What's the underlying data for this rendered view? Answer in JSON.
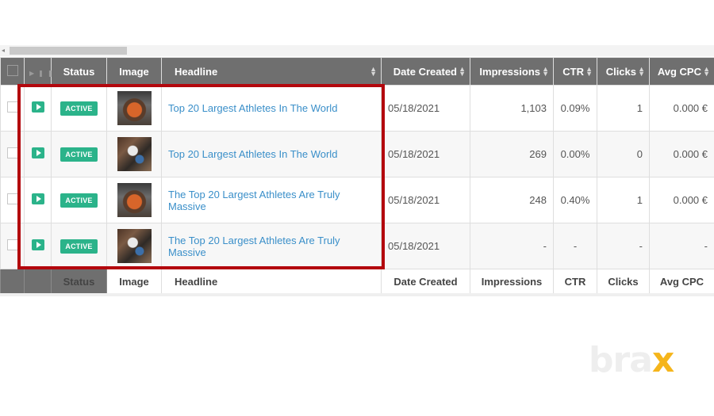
{
  "scrollbar": {
    "left_arrow_icon": "◂"
  },
  "columns": {
    "status": "Status",
    "image": "Image",
    "headline": "Headline",
    "date_created": "Date Created",
    "impressions": "Impressions",
    "ctr": "CTR",
    "clicks": "Clicks",
    "avg_cpc": "Avg CPC"
  },
  "header_icons": {
    "play": "▶",
    "pause": "❚❚",
    "sort": "sort-arrows-icon"
  },
  "rows": [
    {
      "status": "ACTIVE",
      "image": "athlete-thumbnail-1",
      "headline": "Top 20 Largest Athletes In The World",
      "date_created": "05/18/2021",
      "impressions": "1,103",
      "ctr": "0.09%",
      "clicks": "1",
      "avg_cpc": "0.000 €"
    },
    {
      "status": "ACTIVE",
      "image": "athlete-thumbnail-2",
      "headline": "Top 20 Largest Athletes In The World",
      "date_created": "05/18/2021",
      "impressions": "269",
      "ctr": "0.00%",
      "clicks": "0",
      "avg_cpc": "0.000 €"
    },
    {
      "status": "ACTIVE",
      "image": "athlete-thumbnail-1",
      "headline": "The Top 20 Largest Athletes Are Truly Massive",
      "date_created": "05/18/2021",
      "impressions": "248",
      "ctr": "0.40%",
      "clicks": "1",
      "avg_cpc": "0.000 €"
    },
    {
      "status": "ACTIVE",
      "image": "athlete-thumbnail-2",
      "headline": "The Top 20 Largest Athletes Are Truly Massive",
      "date_created": "05/18/2021",
      "impressions": "-",
      "ctr": "-",
      "clicks": "-",
      "avg_cpc": "-"
    }
  ],
  "brand": {
    "text": "bra",
    "accent": "x",
    "accent_color": "#f5b51b"
  },
  "colors": {
    "highlight": "#b3070d",
    "active": "#2bb38a",
    "link": "#3a8fc9",
    "header_bg": "#6f6f6f"
  }
}
